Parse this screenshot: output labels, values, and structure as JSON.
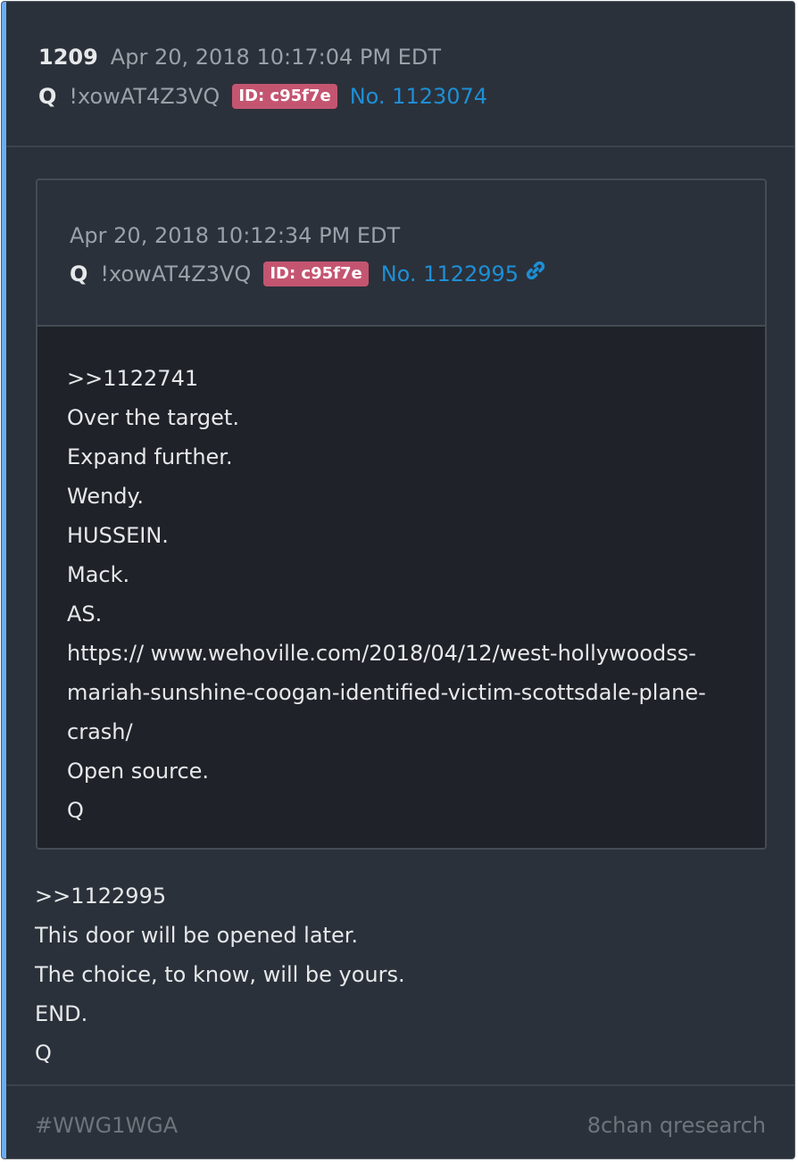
{
  "post": {
    "number": "1209",
    "timestamp": "Apr 20, 2018 10:17:04 PM EDT",
    "author": "Q",
    "tripcode": "!xowAT4Z3VQ",
    "id_badge": "ID: c95f7e",
    "post_link": "No. 1123074"
  },
  "quoted_post": {
    "timestamp": "Apr 20, 2018 10:12:34 PM EDT",
    "author": "Q",
    "tripcode": "!xowAT4Z3VQ",
    "id_badge": "ID: c95f7e",
    "post_link": "No. 1122995",
    "lines": [
      ">>1122741",
      "Over the target.",
      "Expand further.",
      "Wendy.",
      "HUSSEIN.",
      "Mack.",
      "AS.",
      "https:// www.wehoville.com/2018/04/12/west-hollywoodss-",
      "mariah-sunshine-coogan-identified-victim-scottsdale-plane-",
      "crash/",
      "Open source.",
      "Q"
    ]
  },
  "body_lines": [
    ">>1122995",
    "This door will be opened later.",
    "The choice, to know, will be yours.",
    "END.",
    "Q"
  ],
  "footer": {
    "hashtag": "#WWG1WGA",
    "source": "8chan qresearch"
  },
  "colors": {
    "accent": "#6aaef4",
    "id_badge": "#c45571",
    "link": "#1e8fd6"
  },
  "icons": {
    "quoted_link": "link-icon"
  }
}
